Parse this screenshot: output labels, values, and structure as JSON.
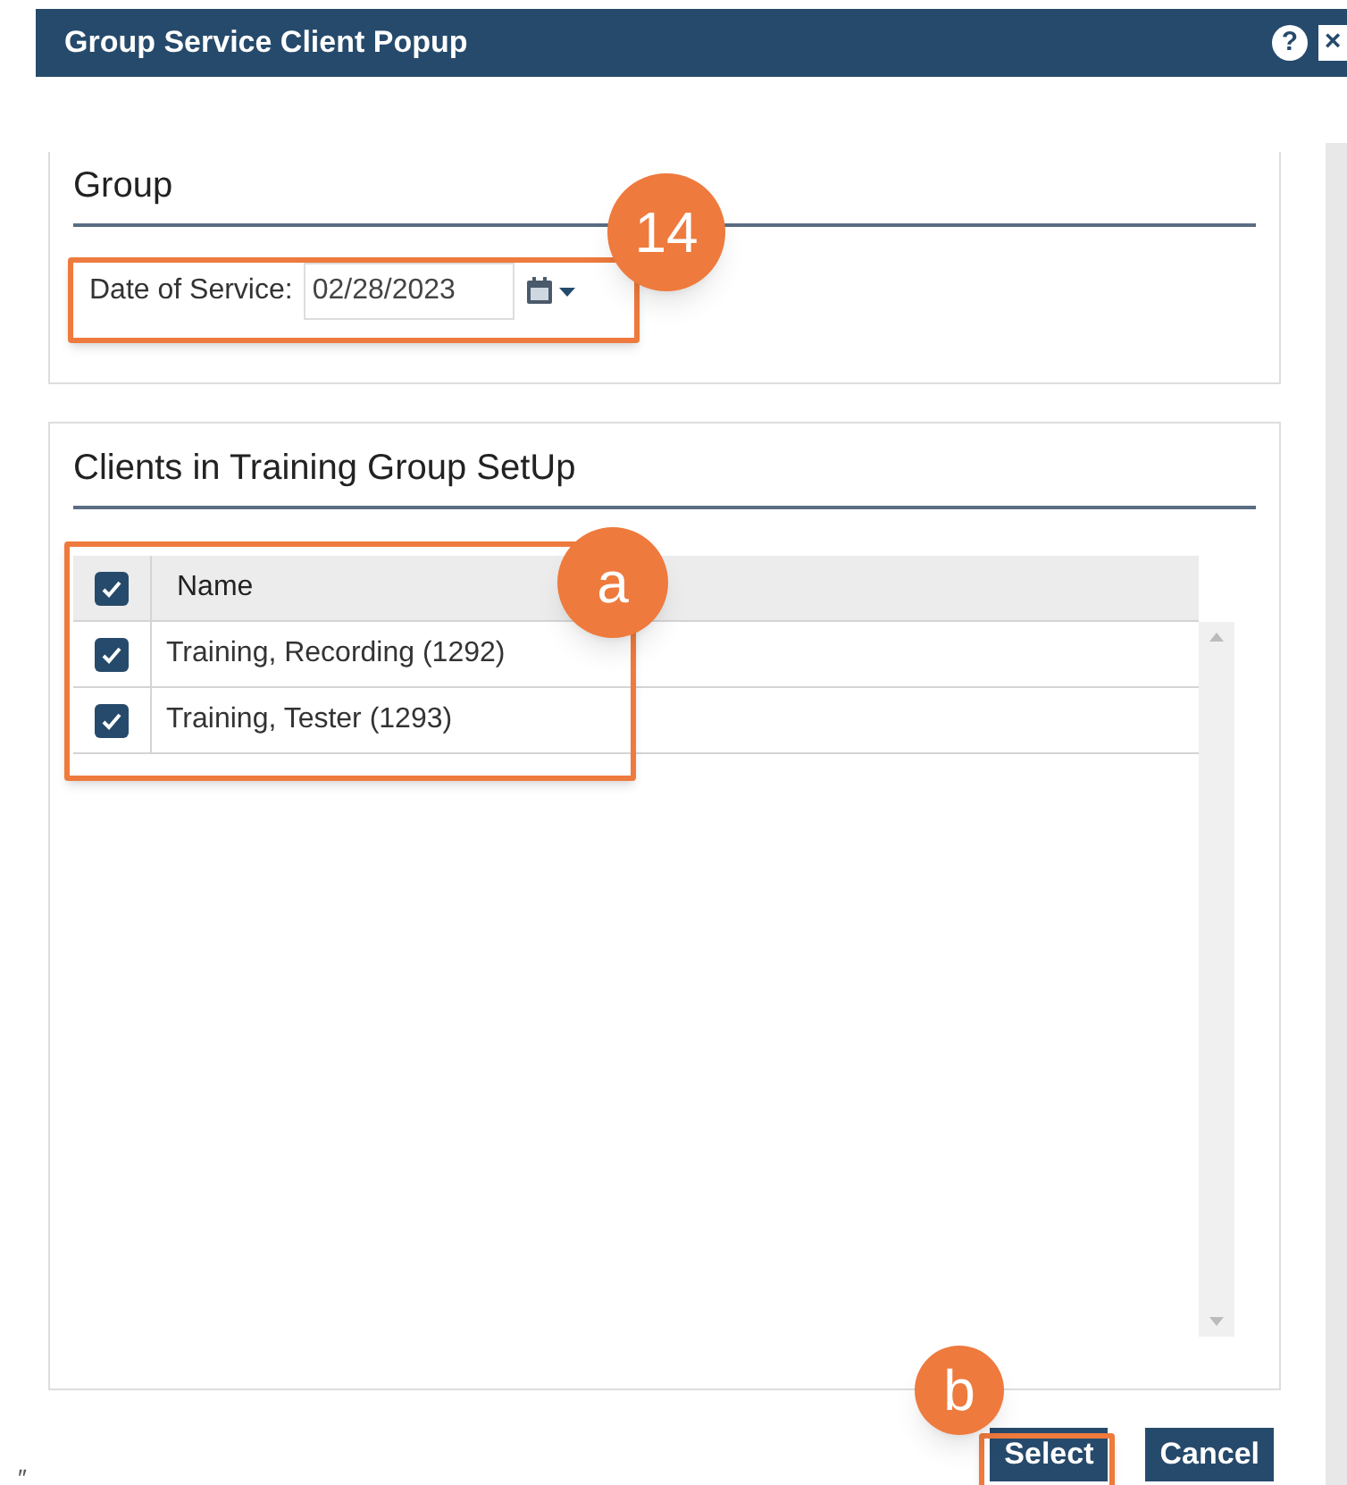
{
  "window": {
    "title": "Group Service Client Popup",
    "help_icon": "?",
    "close_icon": "×"
  },
  "group_panel": {
    "title": "Group",
    "date_label": "Date of Service:",
    "date_value": "02/28/2023"
  },
  "clients_panel": {
    "title": "Clients in Training Group SetUp",
    "table": {
      "select_all_checked": true,
      "columns": [
        "Name"
      ],
      "rows": [
        {
          "name": "Training, Recording (1292)",
          "checked": true
        },
        {
          "name": "Training, Tester (1293)",
          "checked": true
        }
      ]
    }
  },
  "buttons": [
    {
      "label": "Select",
      "kind": "primary"
    },
    {
      "label": "Cancel",
      "kind": "primary"
    }
  ],
  "annotations": [
    {
      "label": "14"
    },
    {
      "label": "a"
    },
    {
      "label": "b"
    }
  ],
  "stray_mark": "″"
}
